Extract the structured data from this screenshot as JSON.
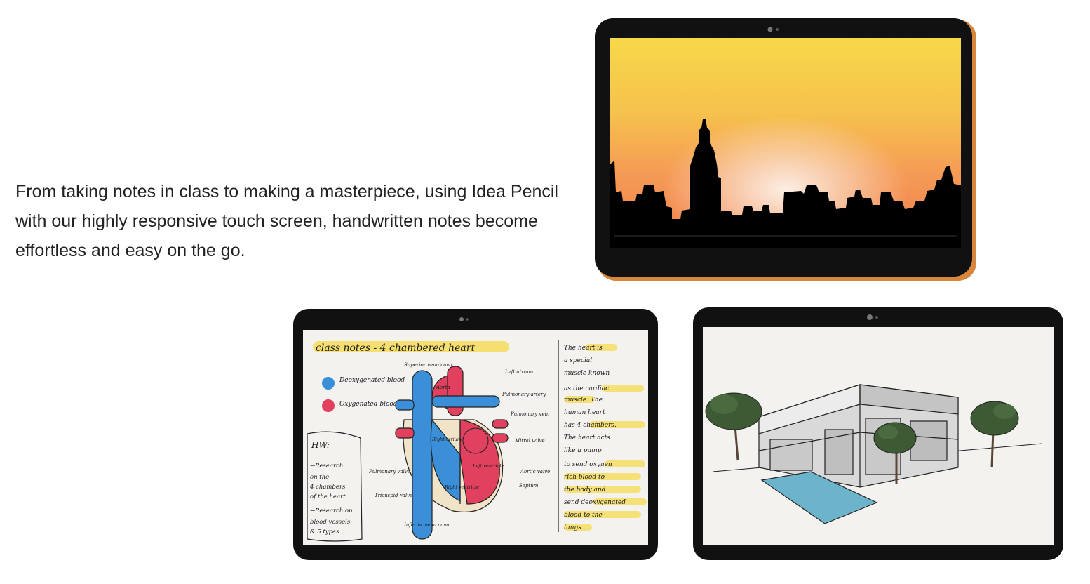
{
  "description": {
    "text": "From taking notes in class to making a masterpiece, using Idea Pencil with our highly responsive touch screen, handwritten notes become effortless and easy on the go."
  },
  "illustrations": {
    "sunset": {
      "colors": {
        "sky_top": "#f6cf45",
        "sky_mid": "#f6a25a",
        "sky_glow": "#fbe9de",
        "skyline": "#000000",
        "frame_accent": "#d7863c"
      }
    },
    "notes": {
      "title": "class notes - 4 chambered heart",
      "legend": [
        "Deoxygenated blood",
        "Oxygenated blood."
      ],
      "hw_label": "HW:",
      "hw_lines": [
        "→Research",
        "on the",
        "4 chambers",
        "of the heart",
        "→Research on",
        "blood vessels",
        "& 5 types"
      ],
      "diagram_labels": {
        "superior_vena_cava": "Superior vena cava",
        "aorta": "Aorta",
        "left_atrium": "Left atrium",
        "pulmonary_artery": "Pulmonary artery",
        "pulmonary_vein": "Pulmonary vein",
        "mitral_valve": "Mitral valve",
        "right_atrium": "Right atrium",
        "pulmonary_valve": "Pulmonary valve",
        "tricuspid_valve": "Tricuspid valve",
        "right_ventricle": "Right ventricle",
        "left_ventricle": "Left ventricle",
        "aortic_valve": "Aortic valve",
        "septum": "Septum",
        "inferior_vena_cava": "Inferior vena cava"
      },
      "side_lines": [
        "The heart is",
        "a special",
        "muscle known",
        "as the cardiac",
        "muscle. The",
        "human heart",
        "has 4 chambers.",
        "The heart acts",
        "like a pump",
        "to send oxygen",
        "rich blood to",
        "the body and",
        "send deoxygenated",
        "blood to the",
        "lungs."
      ],
      "colors": {
        "blue": "#3a8fd8",
        "red": "#e2405f",
        "highlight": "#f5dc5a",
        "paper": "#f4f2ee"
      }
    },
    "house": {
      "colors": {
        "pool": "#6cb4cc",
        "tree": "#3d5a35",
        "walls": "#d9d9d9",
        "paper": "#f4f2ee"
      }
    }
  }
}
